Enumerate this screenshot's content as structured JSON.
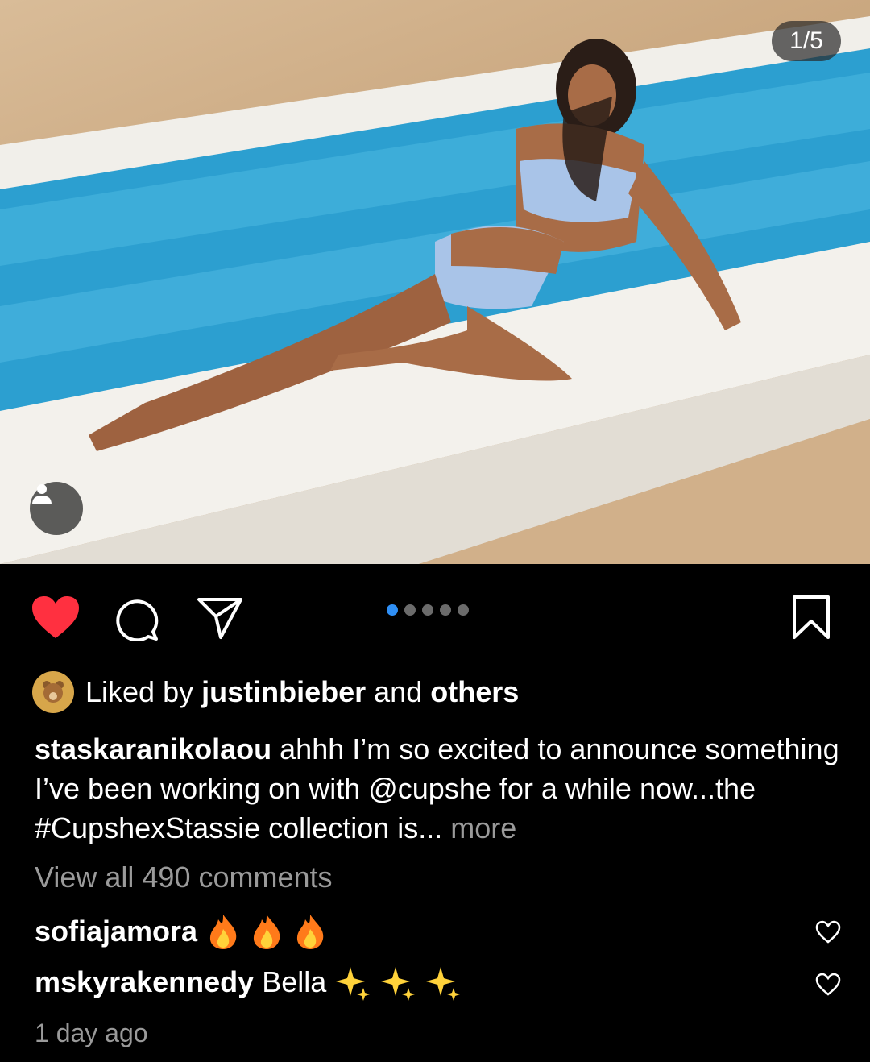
{
  "photo": {
    "counter": "1/5"
  },
  "carousel": {
    "total": 5,
    "active_index": 0
  },
  "likes": {
    "prefix": "Liked by",
    "user": "justinbieber",
    "and": "and",
    "others": "others"
  },
  "caption": {
    "username": "staskaranikolaou",
    "text": "ahhh I’m so excited to announce something I’ve been working on with @cupshe for a while now...the #CupshexStassie collection is...",
    "more": "more"
  },
  "view_all": "View all 490 comments",
  "comments": [
    {
      "username": "sofiajamora",
      "text": "",
      "emoji": [
        "fire",
        "fire",
        "fire"
      ]
    },
    {
      "username": "mskyrakennedy",
      "text": "Bella",
      "emoji": [
        "sparkles",
        "sparkles",
        "sparkles"
      ]
    }
  ],
  "timestamp": "1 day ago",
  "colors": {
    "like_red": "#ff3040",
    "active_dot": "#2f8ff5",
    "muted_text": "#9a9a9a"
  }
}
